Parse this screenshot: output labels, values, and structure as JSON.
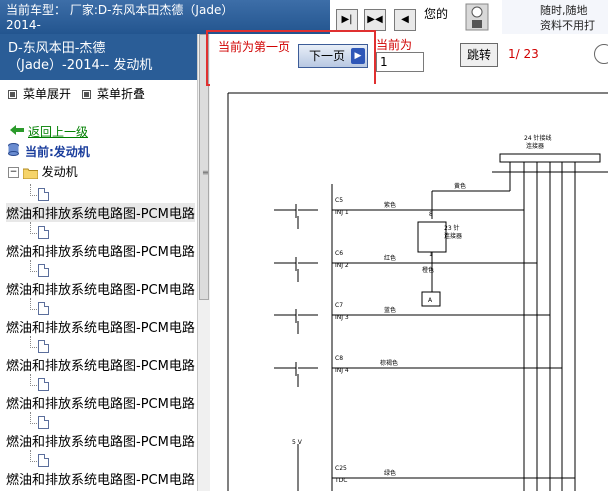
{
  "header": {
    "car_type_line1": "当前车型： 厂家:D-东风本田杰德（Jade）",
    "car_type_line2": "2014-",
    "ad_text": "您的",
    "ad_line1": "随时,随地",
    "ad_line2": "资料不用打"
  },
  "sidebar": {
    "heading_line1": "D-东风本田-杰德",
    "heading_line2": "（Jade）-2014-- 发动机",
    "menu_expand": "菜单展开",
    "menu_collapse": "菜单折叠",
    "back_link": "返回上一级",
    "current": "当前:发动机",
    "folder": "发动机",
    "items": [
      {
        "label": "燃油和排放系统电路图-PCM电路"
      },
      {
        "label": "燃油和排放系统电路图-PCM电路"
      },
      {
        "label": "燃油和排放系统电路图-PCM电路"
      },
      {
        "label": "燃油和排放系统电路图-PCM电路"
      },
      {
        "label": "燃油和排放系统电路图-PCM电路"
      },
      {
        "label": "燃油和排放系统电路图-PCM电路"
      },
      {
        "label": "燃油和排放系统电路图-PCM电路"
      },
      {
        "label": "燃油和排放系统电路图-PCM电路"
      }
    ]
  },
  "toolbar": {
    "first_page_label": "当前为第一页",
    "next_page": "下一页",
    "current_label": "当前为",
    "page_value": "1",
    "jump": "跳转",
    "page_count": "1/ 23"
  },
  "diagram": {
    "connector_label_1": "24 针接线",
    "connector_label_2": "连接器",
    "wire_yellow": "黄色",
    "wire_purple": "紫色",
    "wire_red": "红色",
    "wire_blue": "蓝色",
    "wire_brown": "棕褐色",
    "wire_green": "绿色",
    "wire_orange": "橙色",
    "connector23_1": "23 针",
    "connector23_2": "连接器",
    "pin_8": "8",
    "pin_1": "1",
    "ground_a": "A",
    "c5": "C5",
    "inj1": "INJ 1",
    "c6": "C6",
    "inj2": "INJ 2",
    "c7": "C7",
    "inj3": "INJ 3",
    "c8": "C8",
    "inj4": "INJ 4",
    "voltage": "5 V",
    "c25": "C25",
    "tdc": "TDC"
  }
}
